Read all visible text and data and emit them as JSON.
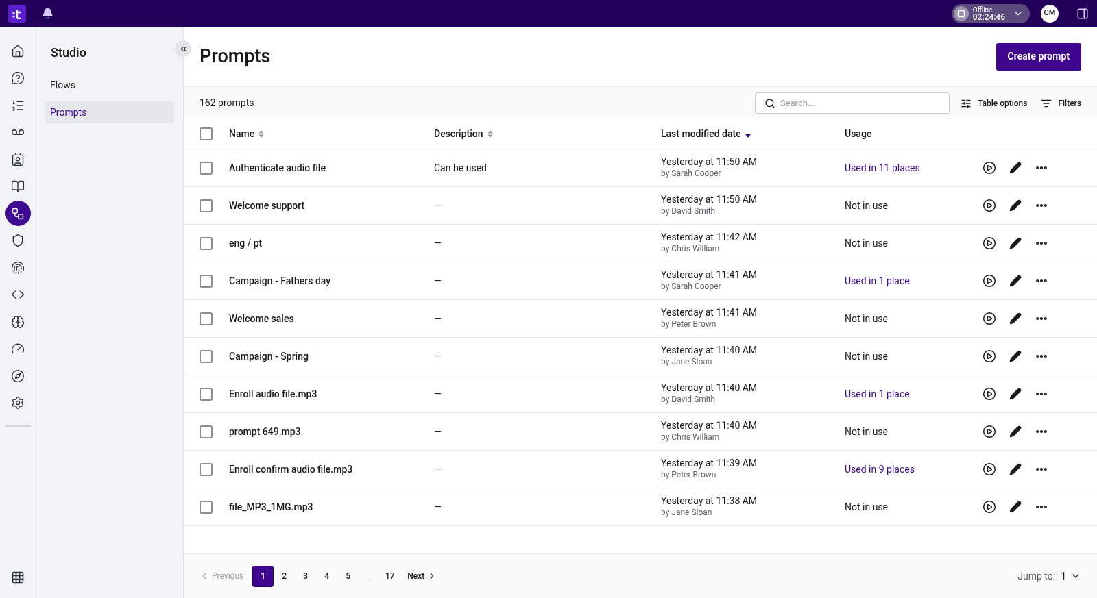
{
  "topbar": {
    "status": {
      "label": "Offline",
      "timer": "02:24:46"
    },
    "avatar": "CM"
  },
  "rail": {
    "items": [
      {
        "kind": "home",
        "selected": false
      },
      {
        "kind": "agent",
        "selected": false
      },
      {
        "kind": "list",
        "selected": false
      },
      {
        "kind": "voicemail",
        "selected": false
      },
      {
        "kind": "contacts",
        "selected": false
      },
      {
        "kind": "book",
        "selected": false
      },
      {
        "kind": "studio",
        "selected": true
      },
      {
        "kind": "shield",
        "selected": false
      },
      {
        "kind": "fingerprint",
        "selected": false
      },
      {
        "kind": "code",
        "selected": false
      },
      {
        "kind": "brain",
        "selected": false
      },
      {
        "kind": "gauge",
        "selected": false
      },
      {
        "kind": "compass",
        "selected": false
      },
      {
        "kind": "settings",
        "selected": false
      }
    ]
  },
  "sidebar": {
    "title": "Studio",
    "items": [
      {
        "label": "Flows",
        "selected": false
      },
      {
        "label": "Prompts",
        "selected": true
      }
    ]
  },
  "page": {
    "title": "Prompts",
    "create_button": "Create prompt"
  },
  "toolbar": {
    "count": "162 prompts",
    "search": {
      "placeholder": "Search..."
    },
    "table_options": "Table options",
    "filters": "Filters"
  },
  "table": {
    "header_checked": false,
    "columns": [
      {
        "label": "Name",
        "sorted": false
      },
      {
        "label": "Description",
        "sorted": false
      },
      {
        "label": "Last modified date",
        "sorted": true
      },
      {
        "label": "Usage"
      }
    ],
    "rows": [
      {
        "checked": false,
        "name": "Authenticate audio file",
        "description": "Can be used",
        "date": "Yesterday at 11:50 AM",
        "by": "by Sarah Cooper",
        "usage": "Used in 11 places",
        "usage_link": true
      },
      {
        "checked": false,
        "name": "Welcome support",
        "description": "—",
        "date": "Yesterday at 11:50 AM",
        "by": "by David Smith",
        "usage": "Not in use",
        "usage_link": false
      },
      {
        "checked": false,
        "name": "eng / pt",
        "description": "—",
        "date": "Yesterday at 11:42 AM",
        "by": "by Chris William",
        "usage": "Not in use",
        "usage_link": false
      },
      {
        "checked": false,
        "name": "Campaign - Fathers day",
        "description": "—",
        "date": "Yesterday at 11:41 AM",
        "by": "by Sarah Cooper",
        "usage": "Used in 1 place",
        "usage_link": true
      },
      {
        "checked": false,
        "name": "Welcome sales",
        "description": "—",
        "date": "Yesterday at 11:41 AM",
        "by": "by Peter Brown",
        "usage": "Not in use",
        "usage_link": false
      },
      {
        "checked": false,
        "name": "Campaign - Spring",
        "description": "—",
        "date": "Yesterday at 11:40 AM",
        "by": "by Jane Sloan",
        "usage": "Not in use",
        "usage_link": false
      },
      {
        "checked": false,
        "name": "Enroll audio file.mp3",
        "description": "—",
        "date": "Yesterday at 11:40 AM",
        "by": "by David Smith",
        "usage": "Used in 1 place",
        "usage_link": true
      },
      {
        "checked": false,
        "name": "prompt 649.mp3",
        "description": "—",
        "date": "Yesterday at 11:40 AM",
        "by": "by Chris William",
        "usage": "Not in use",
        "usage_link": false
      },
      {
        "checked": false,
        "name": "Enroll confirm audio file.mp3",
        "description": "—",
        "date": "Yesterday at 11:39 AM",
        "by": "by Peter Brown",
        "usage": "Used in 9 places",
        "usage_link": true
      },
      {
        "checked": false,
        "name": "file_MP3_1MG.mp3",
        "description": "—",
        "date": "Yesterday at 11:38 AM",
        "by": "by Jane Sloan",
        "usage": "Not in use",
        "usage_link": false
      }
    ]
  },
  "pagination": {
    "previous": {
      "label": "Previous",
      "disabled": true
    },
    "pages": [
      {
        "kind": "page",
        "label": "1",
        "selected": true
      },
      {
        "kind": "page",
        "label": "2",
        "selected": false
      },
      {
        "kind": "page",
        "label": "3",
        "selected": false
      },
      {
        "kind": "page",
        "label": "4",
        "selected": false
      },
      {
        "kind": "page",
        "label": "5",
        "selected": false
      },
      {
        "kind": "ellipsis",
        "label": "..."
      },
      {
        "kind": "page",
        "label": "17",
        "selected": false
      }
    ],
    "next": {
      "label": "Next",
      "disabled": false
    },
    "jump_label": "Jump to:",
    "jump_value": "1"
  }
}
